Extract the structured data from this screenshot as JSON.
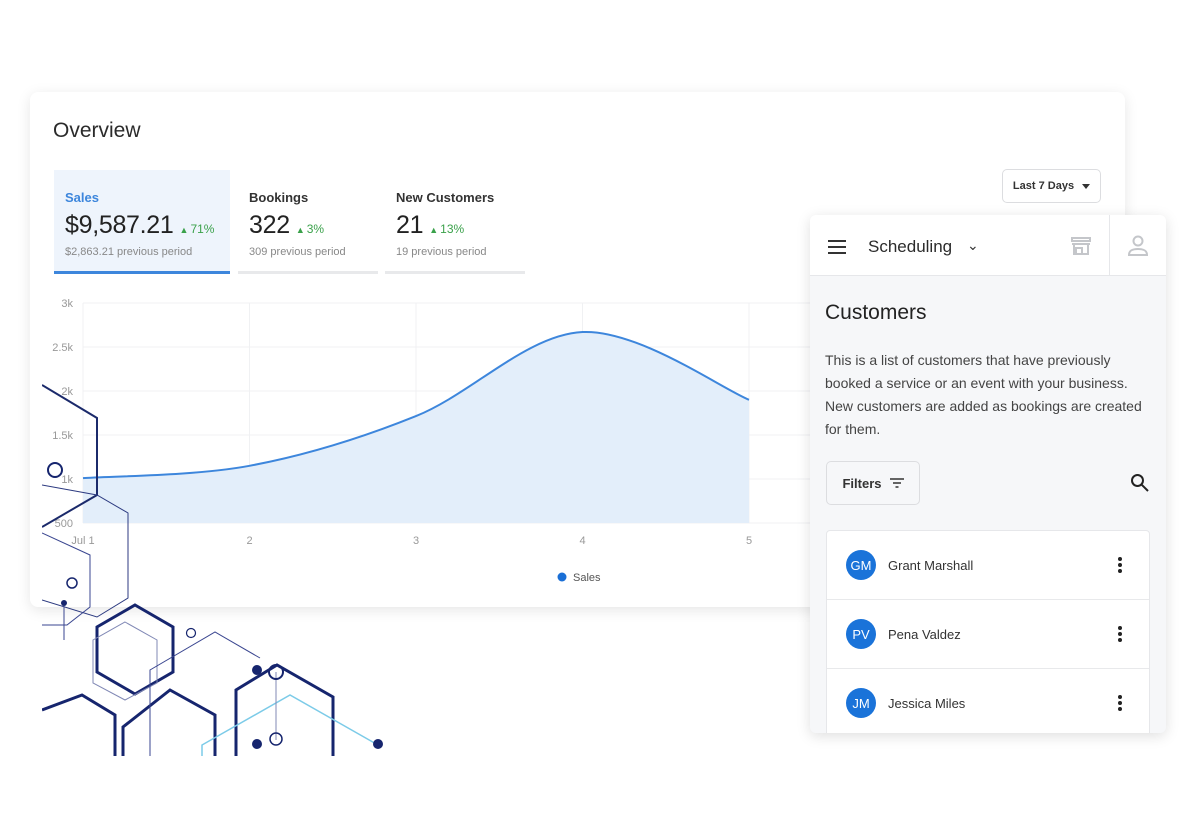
{
  "overview": {
    "title": "Overview",
    "date_range": "Last 7 Days",
    "tabs": [
      {
        "label": "Sales",
        "value": "$9,587.21",
        "delta": "71%",
        "previous": "$2,863.21 previous period",
        "active": true
      },
      {
        "label": "Bookings",
        "value": "322",
        "delta": "3%",
        "previous": "309 previous period",
        "active": false
      },
      {
        "label": "New Customers",
        "value": "21",
        "delta": "13%",
        "previous": "19 previous period",
        "active": false
      }
    ]
  },
  "chart_data": {
    "type": "area",
    "categories": [
      "Jul 1",
      "2",
      "3",
      "4",
      "5"
    ],
    "series": [
      {
        "name": "Sales",
        "values": [
          1010,
          1150,
          1715,
          2670,
          1900
        ]
      }
    ],
    "ylim": [
      500,
      3000
    ],
    "yticks": [
      "500",
      "1k",
      "1.5k",
      "2k",
      "2.5k",
      "3k"
    ],
    "ytick_values": [
      500,
      1000,
      1500,
      2000,
      2500,
      3000
    ],
    "grid": true,
    "legend": "bottom",
    "color": "#3d86dc",
    "fill": "#e3eefa"
  },
  "panel": {
    "app_name": "Scheduling",
    "title": "Customers",
    "description": "This is a list of customers that have previously booked a service or an event with your business. New customers are added as bookings are created for them.",
    "filters_label": "Filters",
    "icons": [
      "menu-icon",
      "chevron-down-icon",
      "store-icon",
      "user-icon",
      "filter-icon",
      "search-icon",
      "more-vertical-icon"
    ],
    "customers": [
      {
        "initials": "GM",
        "name": "Grant Marshall"
      },
      {
        "initials": "PV",
        "name": "Pena Valdez"
      },
      {
        "initials": "JM",
        "name": "Jessica Miles"
      }
    ],
    "avatar_color": "#1a73d9"
  }
}
